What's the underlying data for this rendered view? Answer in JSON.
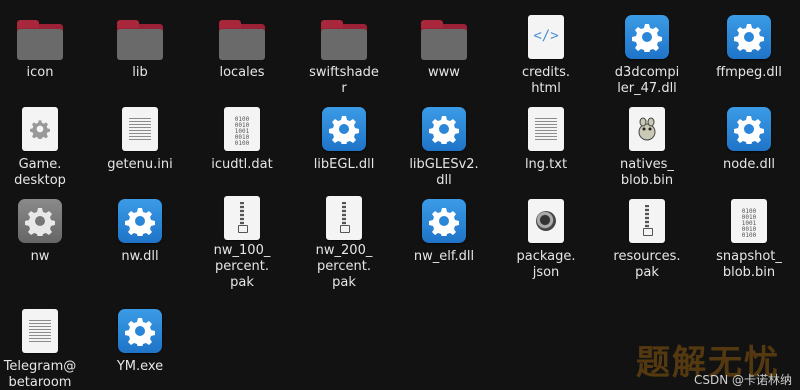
{
  "files": [
    {
      "name": "icon",
      "type": "folder",
      "icon": "folder-icon"
    },
    {
      "name": "lib",
      "type": "folder",
      "icon": "folder-icon"
    },
    {
      "name": "locales",
      "type": "folder",
      "icon": "folder-icon"
    },
    {
      "name": "swiftshade\nr",
      "type": "folder",
      "icon": "folder-icon"
    },
    {
      "name": "www",
      "type": "folder",
      "icon": "folder-icon"
    },
    {
      "name": "credits.\nhtml",
      "type": "html",
      "icon": "html-file-icon"
    },
    {
      "name": "d3dcompi\nler_47.dll",
      "type": "dll",
      "icon": "gear-icon"
    },
    {
      "name": "ffmpeg.dll",
      "type": "dll",
      "icon": "gear-icon"
    },
    {
      "name": "Game.\ndesktop",
      "type": "desktop",
      "icon": "desktop-file-icon"
    },
    {
      "name": "getenu.ini",
      "type": "text",
      "icon": "text-file-icon"
    },
    {
      "name": "icudtl.dat",
      "type": "binary",
      "icon": "binary-file-icon"
    },
    {
      "name": "libEGL.dll",
      "type": "dll",
      "icon": "gear-icon"
    },
    {
      "name": "libGLESv2.\ndll",
      "type": "dll",
      "icon": "gear-icon"
    },
    {
      "name": "lng.txt",
      "type": "text",
      "icon": "text-file-icon"
    },
    {
      "name": "natives_\nblob.bin",
      "type": "bin",
      "icon": "gimp-file-icon"
    },
    {
      "name": "node.dll",
      "type": "dll",
      "icon": "gear-icon"
    },
    {
      "name": "nw",
      "type": "exec",
      "icon": "grey-gear-icon"
    },
    {
      "name": "nw.dll",
      "type": "dll",
      "icon": "gear-icon"
    },
    {
      "name": "nw_100_\npercent.\npak",
      "type": "archive",
      "icon": "archive-file-icon"
    },
    {
      "name": "nw_200_\npercent.\npak",
      "type": "archive",
      "icon": "archive-file-icon"
    },
    {
      "name": "nw_elf.dll",
      "type": "dll",
      "icon": "gear-icon"
    },
    {
      "name": "package.\njson",
      "type": "json",
      "icon": "json-file-icon"
    },
    {
      "name": "resources.\npak",
      "type": "archive",
      "icon": "archive-file-icon"
    },
    {
      "name": "snapshot_\nblob.bin",
      "type": "binary",
      "icon": "binary-file-icon"
    },
    {
      "name": "Telegram@\nbetaroom",
      "type": "text",
      "icon": "text-file-icon"
    },
    {
      "name": "YM.exe",
      "type": "exe",
      "icon": "gear-icon"
    }
  ],
  "binary_text": "0100\n0010\n1001\n0010\n0100",
  "html_symbol": "</>",
  "watermark": {
    "logo_text": "题解无忧",
    "credit": "CSDN @卡诺林纳"
  },
  "colors": {
    "background": "#121212",
    "folder_tab": "#a8273b",
    "folder_body": "#6a6a6a",
    "gear_blue": "#2a86d8"
  }
}
